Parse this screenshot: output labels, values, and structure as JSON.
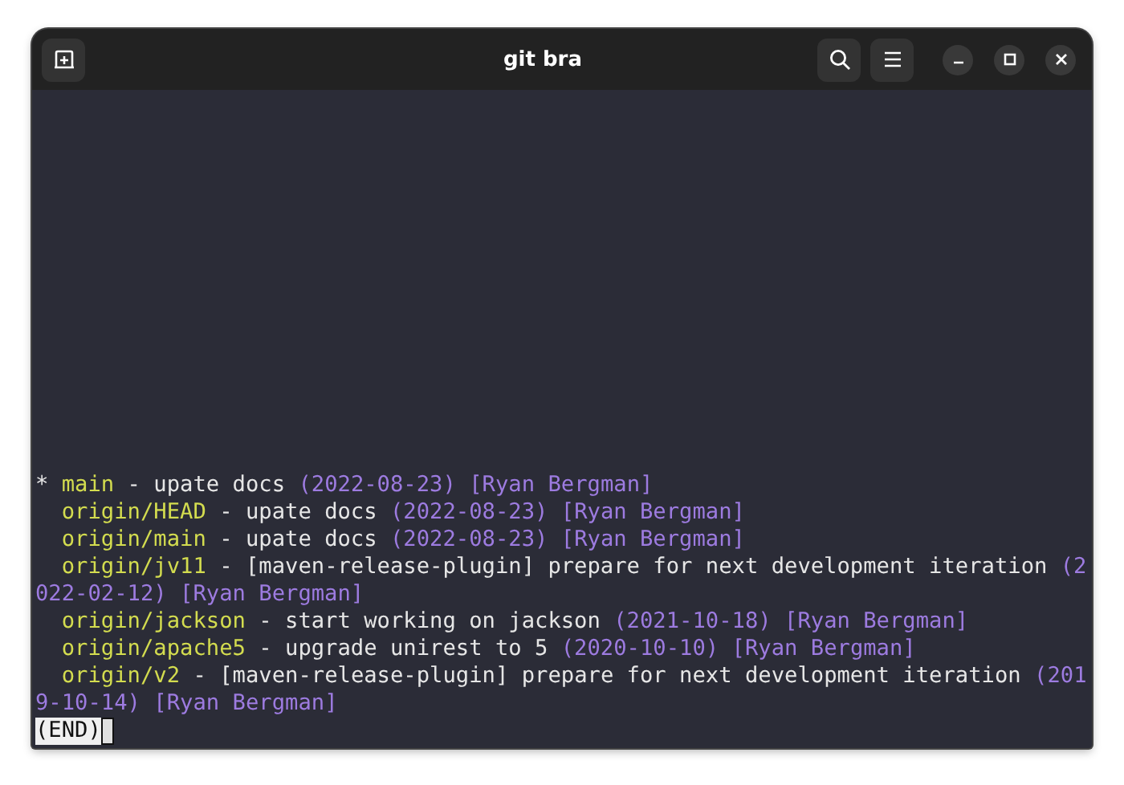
{
  "window": {
    "title": "git bra"
  },
  "branches": [
    {
      "marker": "*",
      "name": "main",
      "separator": "-",
      "subject": "upate docs",
      "date": "(2022-08-23)",
      "author": "[Ryan Bergman]"
    },
    {
      "name": "origin/HEAD",
      "separator": "-",
      "subject": "upate docs",
      "date": "(2022-08-23)",
      "author": "[Ryan Bergman]"
    },
    {
      "name": "origin/main",
      "separator": "-",
      "subject": "upate docs",
      "date": "(2022-08-23)",
      "author": "[Ryan Bergman]"
    },
    {
      "name": "origin/jv11",
      "separator": "-",
      "subject": "[maven-release-plugin] prepare for next development iteration",
      "date": "(2022-02-12)",
      "author": "[Ryan Bergman]"
    },
    {
      "name": "origin/jackson",
      "separator": "-",
      "subject": "start working on jackson",
      "date": "(2021-10-18)",
      "author": "[Ryan Bergman]"
    },
    {
      "name": "origin/apache5",
      "separator": "-",
      "subject": "upgrade unirest to 5",
      "date": "(2020-10-10)",
      "author": "[Ryan Bergman]"
    },
    {
      "name": "origin/v2",
      "separator": "-",
      "subject": "[maven-release-plugin] prepare for next development iteration",
      "date": "(2019-10-14)",
      "author": "[Ryan Bergman]"
    }
  ],
  "pager": {
    "prompt": "(END)"
  }
}
